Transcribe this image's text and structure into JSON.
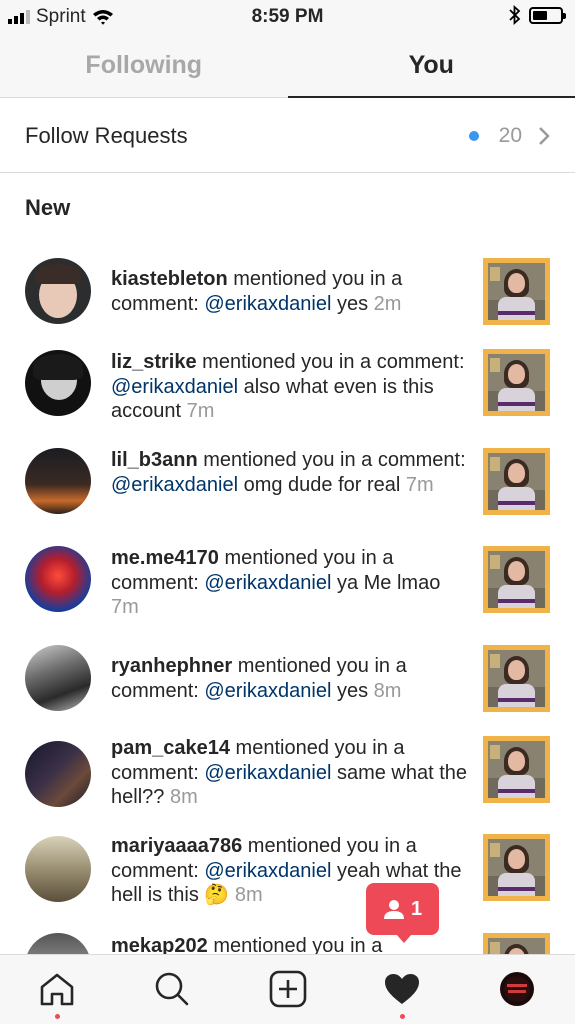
{
  "status_bar": {
    "carrier": "Sprint",
    "time": "8:59 PM"
  },
  "tabs": [
    {
      "label": "Following",
      "active": false
    },
    {
      "label": "You",
      "active": true
    }
  ],
  "follow_requests": {
    "label": "Follow Requests",
    "count": "20"
  },
  "section_title": "New",
  "notifications": [
    {
      "user": "kiastebleton",
      "action": "mentioned you in a comment:",
      "mention": "@erikaxdaniel",
      "text": "yes",
      "time": "2m"
    },
    {
      "user": "liz_strike",
      "action": "mentioned you in a comment:",
      "mention": "@erikaxdaniel",
      "text": "also what even is this account",
      "time": "7m"
    },
    {
      "user": "lil_b3ann",
      "action": "mentioned you in a comment:",
      "mention": "@erikaxdaniel",
      "text": "omg dude for real",
      "time": "7m"
    },
    {
      "user": "me.me4170",
      "action": "mentioned you in a comment:",
      "mention": "@erikaxdaniel",
      "text": "ya Me lmao",
      "time": "7m"
    },
    {
      "user": "ryanhephner",
      "action": "mentioned you in a comment:",
      "mention": "@erikaxdaniel",
      "text": "yes",
      "time": "8m"
    },
    {
      "user": "pam_cake14",
      "action": "mentioned you in a comment:",
      "mention": "@erikaxdaniel",
      "text": "same what the hell??",
      "time": "8m"
    },
    {
      "user": "mariyaaaa786",
      "action": "mentioned you in a comment:",
      "mention": "@erikaxdaniel",
      "text": "yeah what the hell is this 🤔",
      "time": "8m"
    },
    {
      "user": "mekap202",
      "action": "mentioned you in a",
      "mention": "",
      "text": "",
      "time": ""
    }
  ],
  "activity_popup": {
    "count": "1"
  },
  "colors": {
    "accent_blue": "#3897f0",
    "mention_blue": "#003569",
    "notification_red": "#ed4956",
    "thumb_frame": "#f0b34a"
  },
  "icons": [
    "home-icon",
    "search-icon",
    "add-post-icon",
    "heart-icon",
    "profile-avatar"
  ]
}
